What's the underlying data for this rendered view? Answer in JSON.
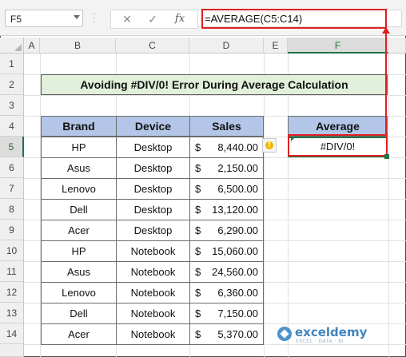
{
  "name_box": "F5",
  "formula_bar": {
    "cancel_icon": "x-icon",
    "confirm_icon": "check-icon",
    "function_icon": "fx-icon",
    "fx_label": "fx",
    "formula": "=AVERAGE(C5:C14)"
  },
  "columns": [
    "A",
    "B",
    "C",
    "D",
    "E",
    "F"
  ],
  "selected_column": "F",
  "rows": [
    "1",
    "2",
    "3",
    "4",
    "5",
    "6",
    "7",
    "8",
    "9",
    "10",
    "11",
    "12",
    "13",
    "14"
  ],
  "selected_row": "5",
  "sheet_title": "Avoiding #DIV/0! Error During Average Calculation",
  "table": {
    "headers": {
      "brand": "Brand",
      "device": "Device",
      "sales": "Sales"
    },
    "currency_symbol": "$",
    "rows": [
      {
        "brand": "HP",
        "device": "Desktop",
        "sales": "8,440.00"
      },
      {
        "brand": "Asus",
        "device": "Desktop",
        "sales": "2,150.00"
      },
      {
        "brand": "Lenovo",
        "device": "Desktop",
        "sales": "6,500.00"
      },
      {
        "brand": "Dell",
        "device": "Desktop",
        "sales": "13,120.00"
      },
      {
        "brand": "Acer",
        "device": "Desktop",
        "sales": "6,290.00"
      },
      {
        "brand": "HP",
        "device": "Notebook",
        "sales": "15,060.00"
      },
      {
        "brand": "Asus",
        "device": "Notebook",
        "sales": "24,560.00"
      },
      {
        "brand": "Lenovo",
        "device": "Notebook",
        "sales": "6,360.00"
      },
      {
        "brand": "Dell",
        "device": "Notebook",
        "sales": "7,150.00"
      },
      {
        "brand": "Acer",
        "device": "Notebook",
        "sales": "5,370.00"
      }
    ]
  },
  "average": {
    "header": "Average",
    "value": "#DIV/0!"
  },
  "warning_icon": "error-warning-icon",
  "watermark": {
    "name": "exceldemy",
    "tagline": "EXCEL · DATA · BI"
  },
  "colors": {
    "highlight": "#e02020",
    "table_header": "#b4c6e7",
    "title_fill": "#e2efda",
    "selection": "#217346"
  }
}
